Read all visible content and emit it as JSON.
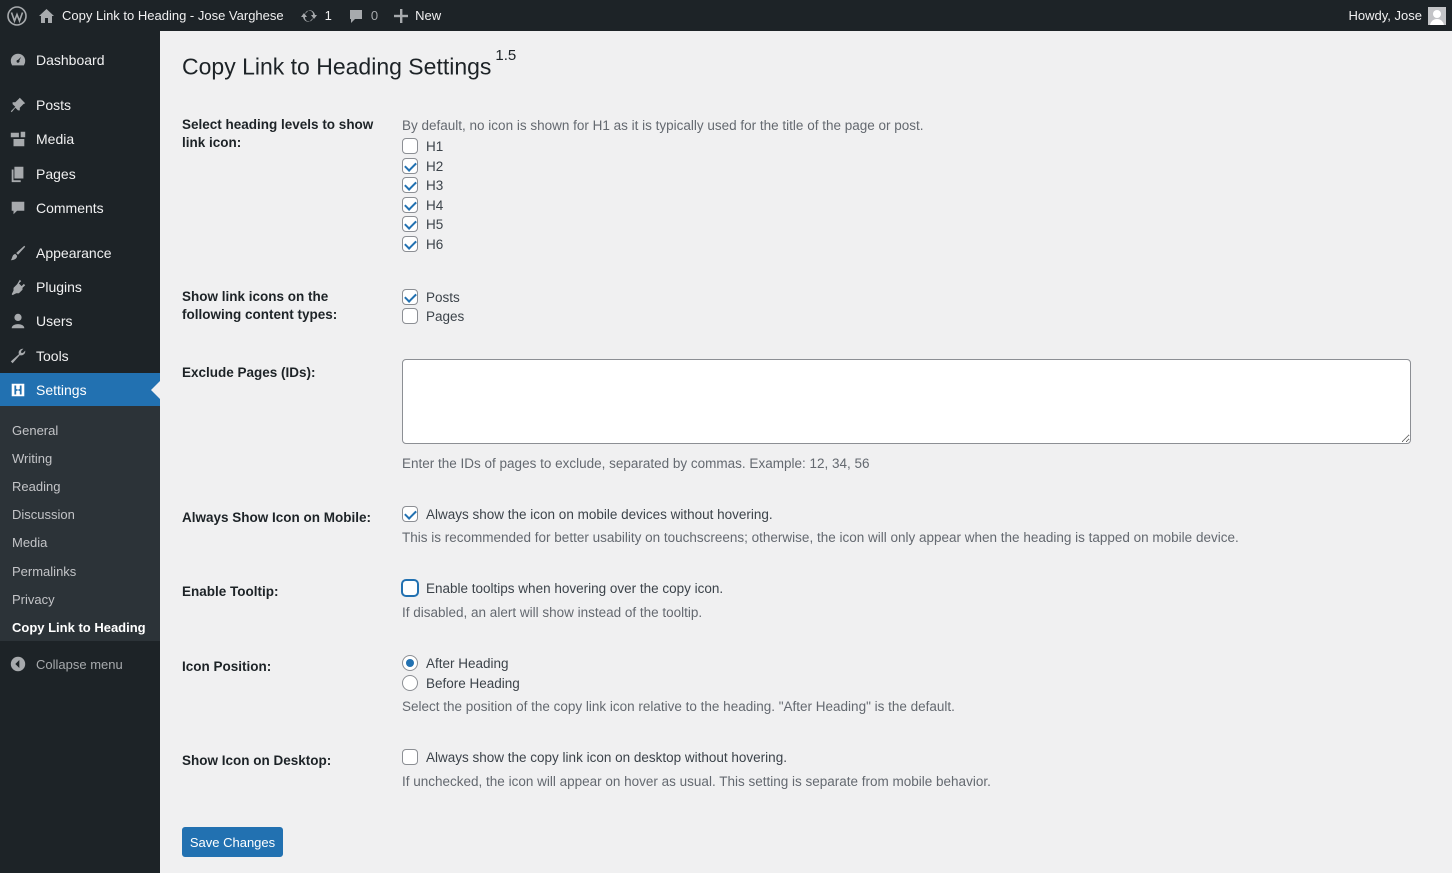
{
  "adminbar": {
    "site_name": "Copy Link to Heading - Jose Varghese",
    "updates_count": "1",
    "comments_count": "0",
    "new_label": "New",
    "howdy": "Howdy, Jose",
    "icons": [
      "wordpress-logo-icon",
      "home-icon",
      "updates-icon",
      "comments-icon",
      "plus-icon"
    ]
  },
  "sidebar": {
    "items": [
      {
        "label": "Dashboard",
        "icon": "dashboard-icon"
      },
      {
        "label": "Posts",
        "icon": "pin-icon"
      },
      {
        "label": "Media",
        "icon": "media-icon"
      },
      {
        "label": "Pages",
        "icon": "pages-icon"
      },
      {
        "label": "Comments",
        "icon": "comments-icon"
      },
      {
        "label": "Appearance",
        "icon": "brush-icon"
      },
      {
        "label": "Plugins",
        "icon": "plugin-icon"
      },
      {
        "label": "Users",
        "icon": "users-icon"
      },
      {
        "label": "Tools",
        "icon": "wrench-icon"
      },
      {
        "label": "Settings",
        "icon": "settings-icon",
        "current": true
      }
    ],
    "submenu": [
      "General",
      "Writing",
      "Reading",
      "Discussion",
      "Media",
      "Permalinks",
      "Privacy",
      "Copy Link to Heading"
    ],
    "submenu_current": "Copy Link to Heading",
    "collapse_label": "Collapse menu"
  },
  "page": {
    "title": "Copy Link to Heading Settings",
    "version": "1.5"
  },
  "settings": {
    "heading_levels": {
      "label": "Select heading levels to show link icon:",
      "description": "By default, no icon is shown for H1 as it is typically used for the title of the page or post.",
      "options": [
        {
          "label": "H1",
          "checked": false
        },
        {
          "label": "H2",
          "checked": true
        },
        {
          "label": "H3",
          "checked": true
        },
        {
          "label": "H4",
          "checked": true
        },
        {
          "label": "H5",
          "checked": true
        },
        {
          "label": "H6",
          "checked": true
        }
      ]
    },
    "content_types": {
      "label": "Show link icons on the following content types:",
      "options": [
        {
          "label": "Posts",
          "checked": true
        },
        {
          "label": "Pages",
          "checked": false
        }
      ]
    },
    "exclude_pages": {
      "label": "Exclude Pages (IDs):",
      "value": "",
      "description": "Enter the IDs of pages to exclude, separated by commas. Example: 12, 34, 56"
    },
    "mobile": {
      "label": "Always Show Icon on Mobile:",
      "option": "Always show the icon on mobile devices without hovering.",
      "checked": true,
      "description": "This is recommended for better usability on touchscreens; otherwise, the icon will only appear when the heading is tapped on mobile device."
    },
    "tooltip": {
      "label": "Enable Tooltip:",
      "option": "Enable tooltips when hovering over the copy icon.",
      "checked": false,
      "description": "If disabled, an alert will show instead of the tooltip."
    },
    "icon_position": {
      "label": "Icon Position:",
      "options": [
        {
          "label": "After Heading",
          "checked": true
        },
        {
          "label": "Before Heading",
          "checked": false
        }
      ],
      "description": "Select the position of the copy link icon relative to the heading. \"After Heading\" is the default."
    },
    "desktop": {
      "label": "Show Icon on Desktop:",
      "option": "Always show the copy link icon on desktop without hovering.",
      "checked": false,
      "description": "If unchecked, the icon will appear on hover as usual. This setting is separate from mobile behavior."
    }
  },
  "save_label": "Save Changes",
  "colors": {
    "admin_bar": "#1d2327",
    "accent": "#2271b1",
    "background": "#f0f0f1",
    "submenu_bg": "#2c3338"
  }
}
